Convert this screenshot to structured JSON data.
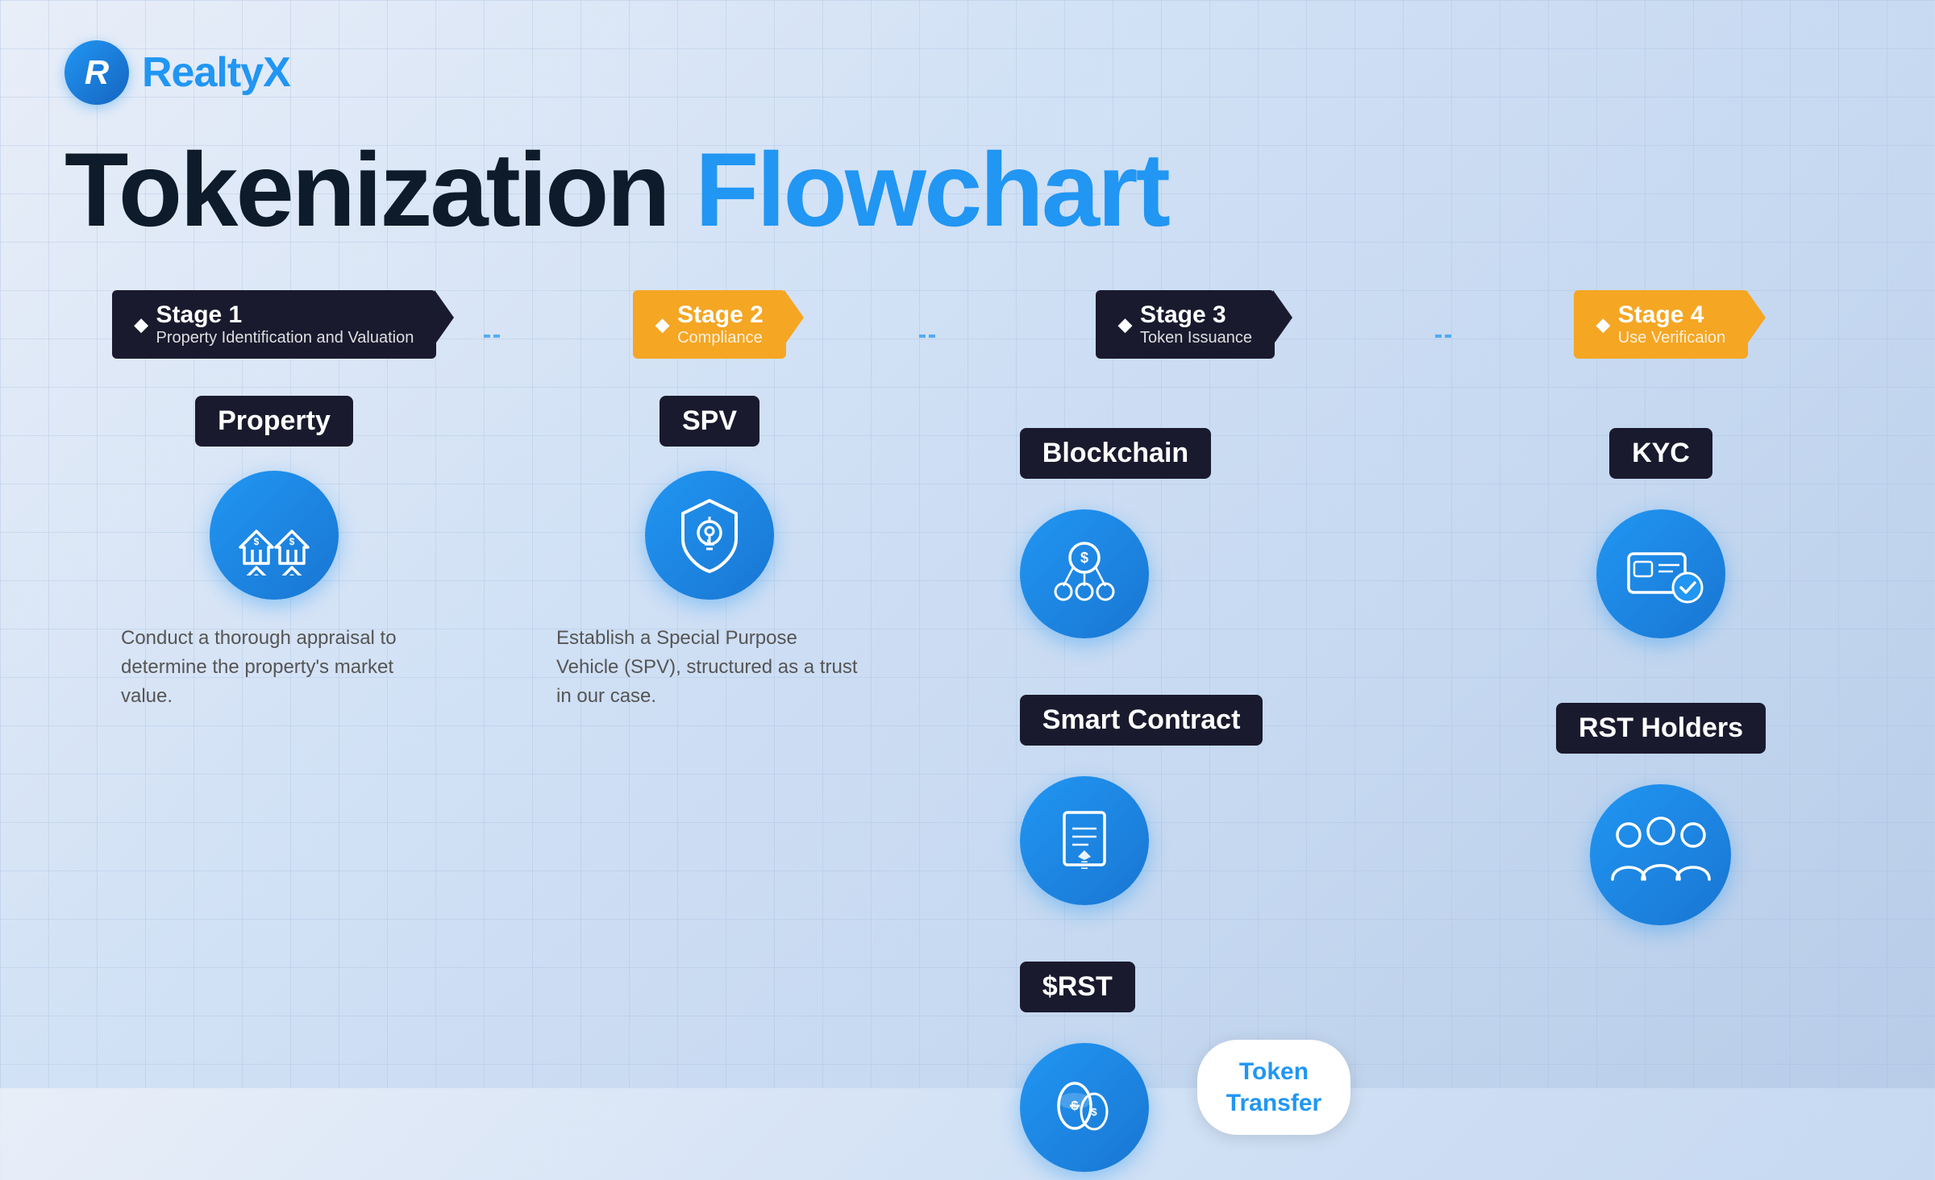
{
  "logo": {
    "letter": "R",
    "name_plain": "Realty",
    "name_highlight": "X"
  },
  "title": {
    "word1": "Tokenization",
    "word2": "Flowchart"
  },
  "stages": [
    {
      "id": "stage1",
      "number": "Stage 1",
      "subtitle": "Property Identification and Valuation",
      "color": "black",
      "node_label": "Property",
      "description": "Conduct a thorough appraisal to determine the property's market value.",
      "icon": "🏠"
    },
    {
      "id": "stage2",
      "number": "Stage 2",
      "subtitle": "Compliance",
      "color": "gold",
      "node_label": "SPV",
      "description": "Establish a Special Purpose Vehicle (SPV), structured as a trust in our case.",
      "icon": "🛡️"
    },
    {
      "id": "stage3",
      "number": "Stage 3",
      "subtitle": "Token Issuance",
      "color": "black",
      "nodes": [
        "Blockchain",
        "Smart Contract",
        "$RST"
      ],
      "icons": [
        "⛓️",
        "📄",
        "🪙"
      ]
    },
    {
      "id": "stage4",
      "number": "Stage 4",
      "subtitle": "Use Verificaion",
      "color": "gold",
      "nodes": [
        "KYC",
        "RST Holders"
      ],
      "icons": [
        "🪪",
        "👥"
      ]
    }
  ],
  "token_transfer_label": "Token\nTransfer"
}
